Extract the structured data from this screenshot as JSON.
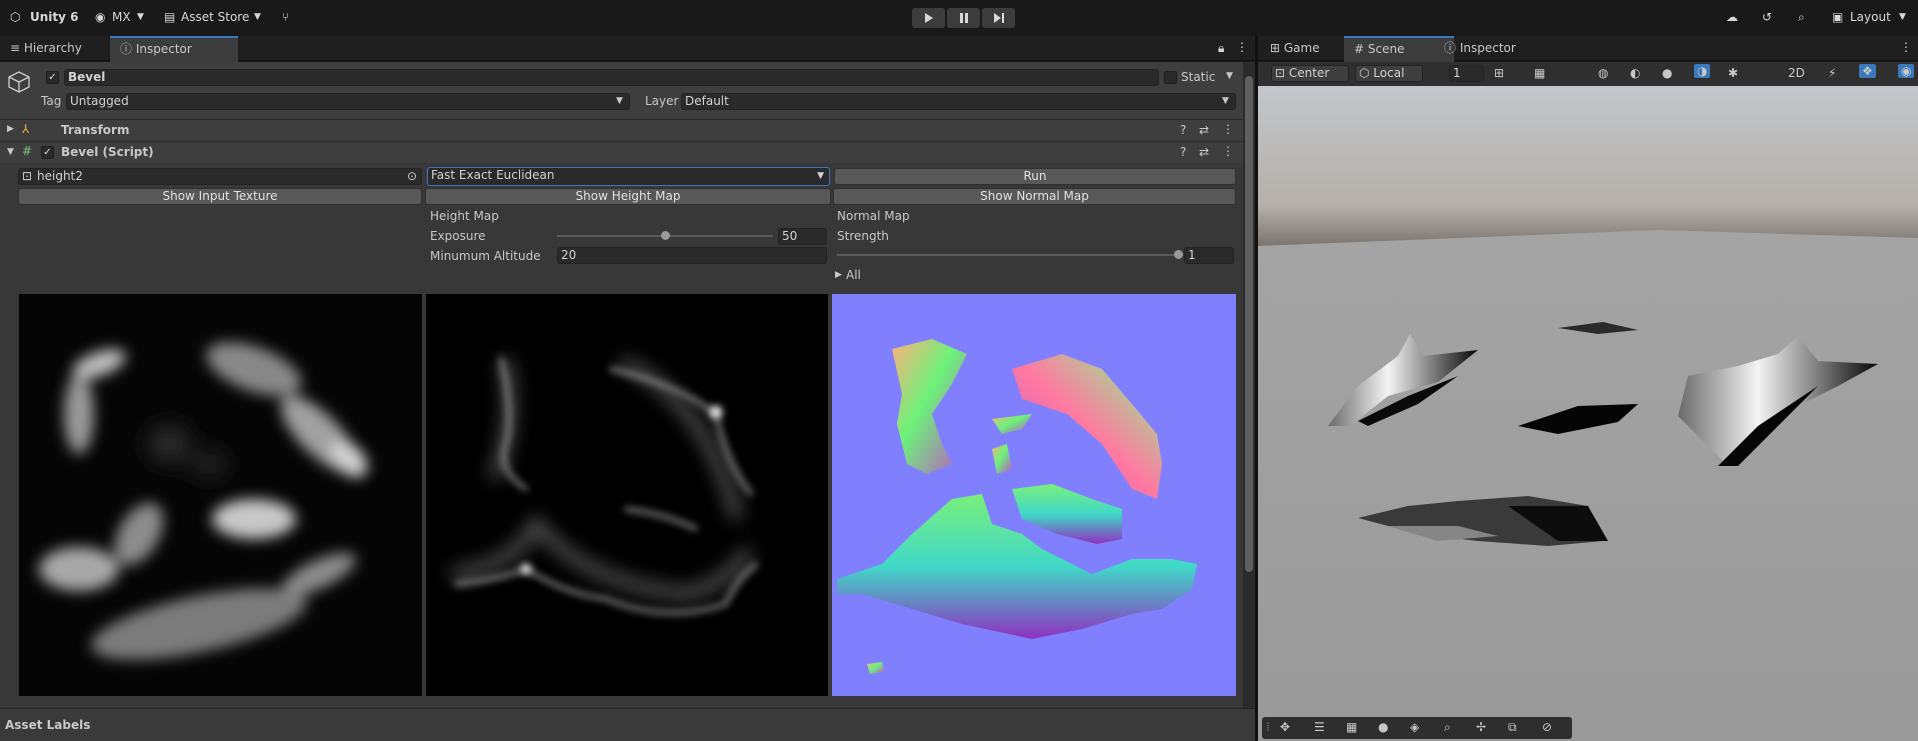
{
  "toolbar": {
    "app_title": "Unity 6",
    "account": "MX",
    "asset_store": "Asset Store",
    "layout": "Layout"
  },
  "left_tabs": [
    "Hierarchy",
    "Inspector"
  ],
  "right_tabs": [
    "Game",
    "Scene",
    "Inspector"
  ],
  "gameobject": {
    "name": "Bevel",
    "static_label": "Static",
    "tag_label": "Tag",
    "tag_value": "Untagged",
    "layer_label": "Layer",
    "layer_value": "Default"
  },
  "components": {
    "transform": "Transform",
    "script": "Bevel (Script)"
  },
  "bevel": {
    "texture_name": "height2",
    "algorithm": "Fast Exact Euclidean",
    "run_label": "Run",
    "show_input": "Show Input Texture",
    "show_height": "Show Height Map",
    "show_normal": "Show Normal Map",
    "height_map_label": "Height Map",
    "exposure_label": "Exposure",
    "exposure_value": "50",
    "exposure_fraction": 0.5,
    "min_alt_label": "Minumum Altitude",
    "min_alt_value": "20",
    "normal_map_label": "Normal Map",
    "strength_label": "Strength",
    "strength_value": "1",
    "strength_fraction": 1.0,
    "all_label": "All"
  },
  "footer": {
    "asset_labels": "Asset Labels"
  },
  "scene_toolbar": {
    "pivot": "Center",
    "space": "Local",
    "snap_value": "1"
  },
  "colors": {
    "accent": "#3a79bb",
    "normal_bg": "#8080ff"
  }
}
